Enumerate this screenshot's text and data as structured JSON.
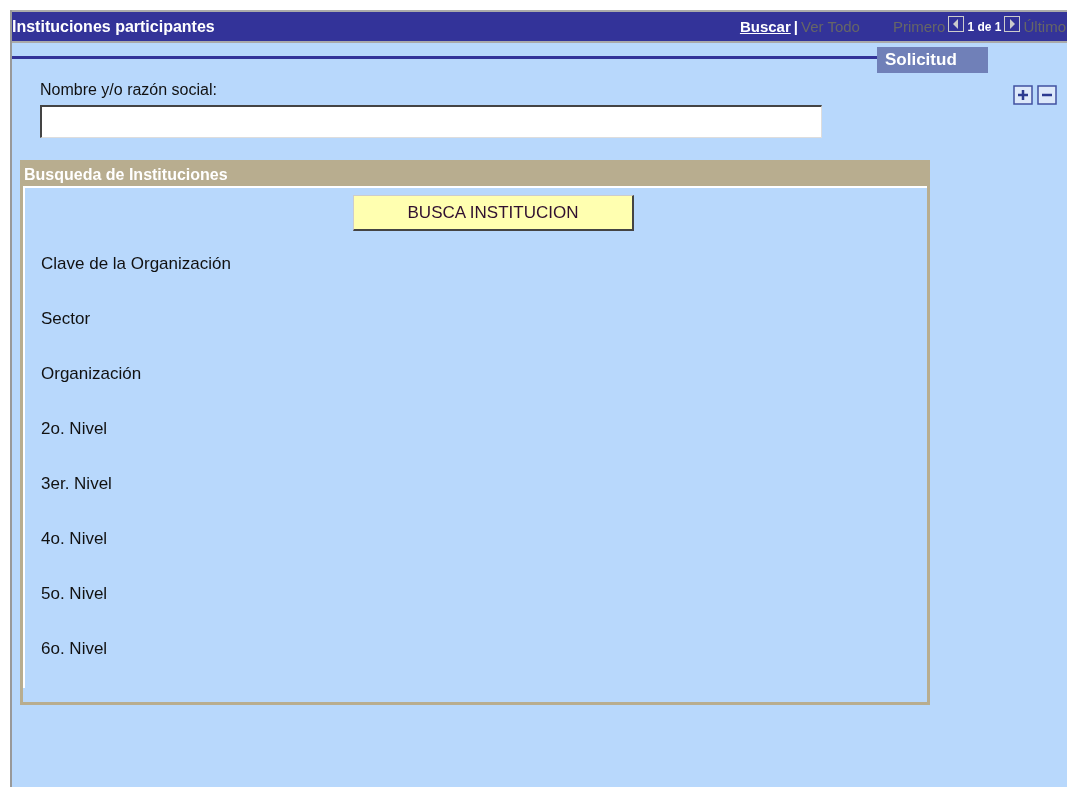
{
  "header": {
    "title": "Instituciones participantes",
    "links": [
      {
        "label": "Buscar",
        "disabled": false
      },
      {
        "label": "Ver Todo",
        "disabled": true
      }
    ],
    "separator": "|",
    "first": {
      "label": "Primero",
      "disabled": true
    },
    "counter": "1 de 1",
    "last": {
      "label": "Último",
      "disabled": true
    }
  },
  "tab": "Solicitud",
  "field": {
    "label": "Nombre y/o razón social:"
  },
  "panel": {
    "title": "Busqueda de Instituciones",
    "button": "BUSCA INSTITUCION",
    "fields": [
      "Clave de la Organización",
      "Sector",
      "Organización",
      "2o. Nivel",
      "3er. Nivel",
      "4o. Nivel",
      "5o. Nivel",
      "6o. Nivel"
    ]
  }
}
